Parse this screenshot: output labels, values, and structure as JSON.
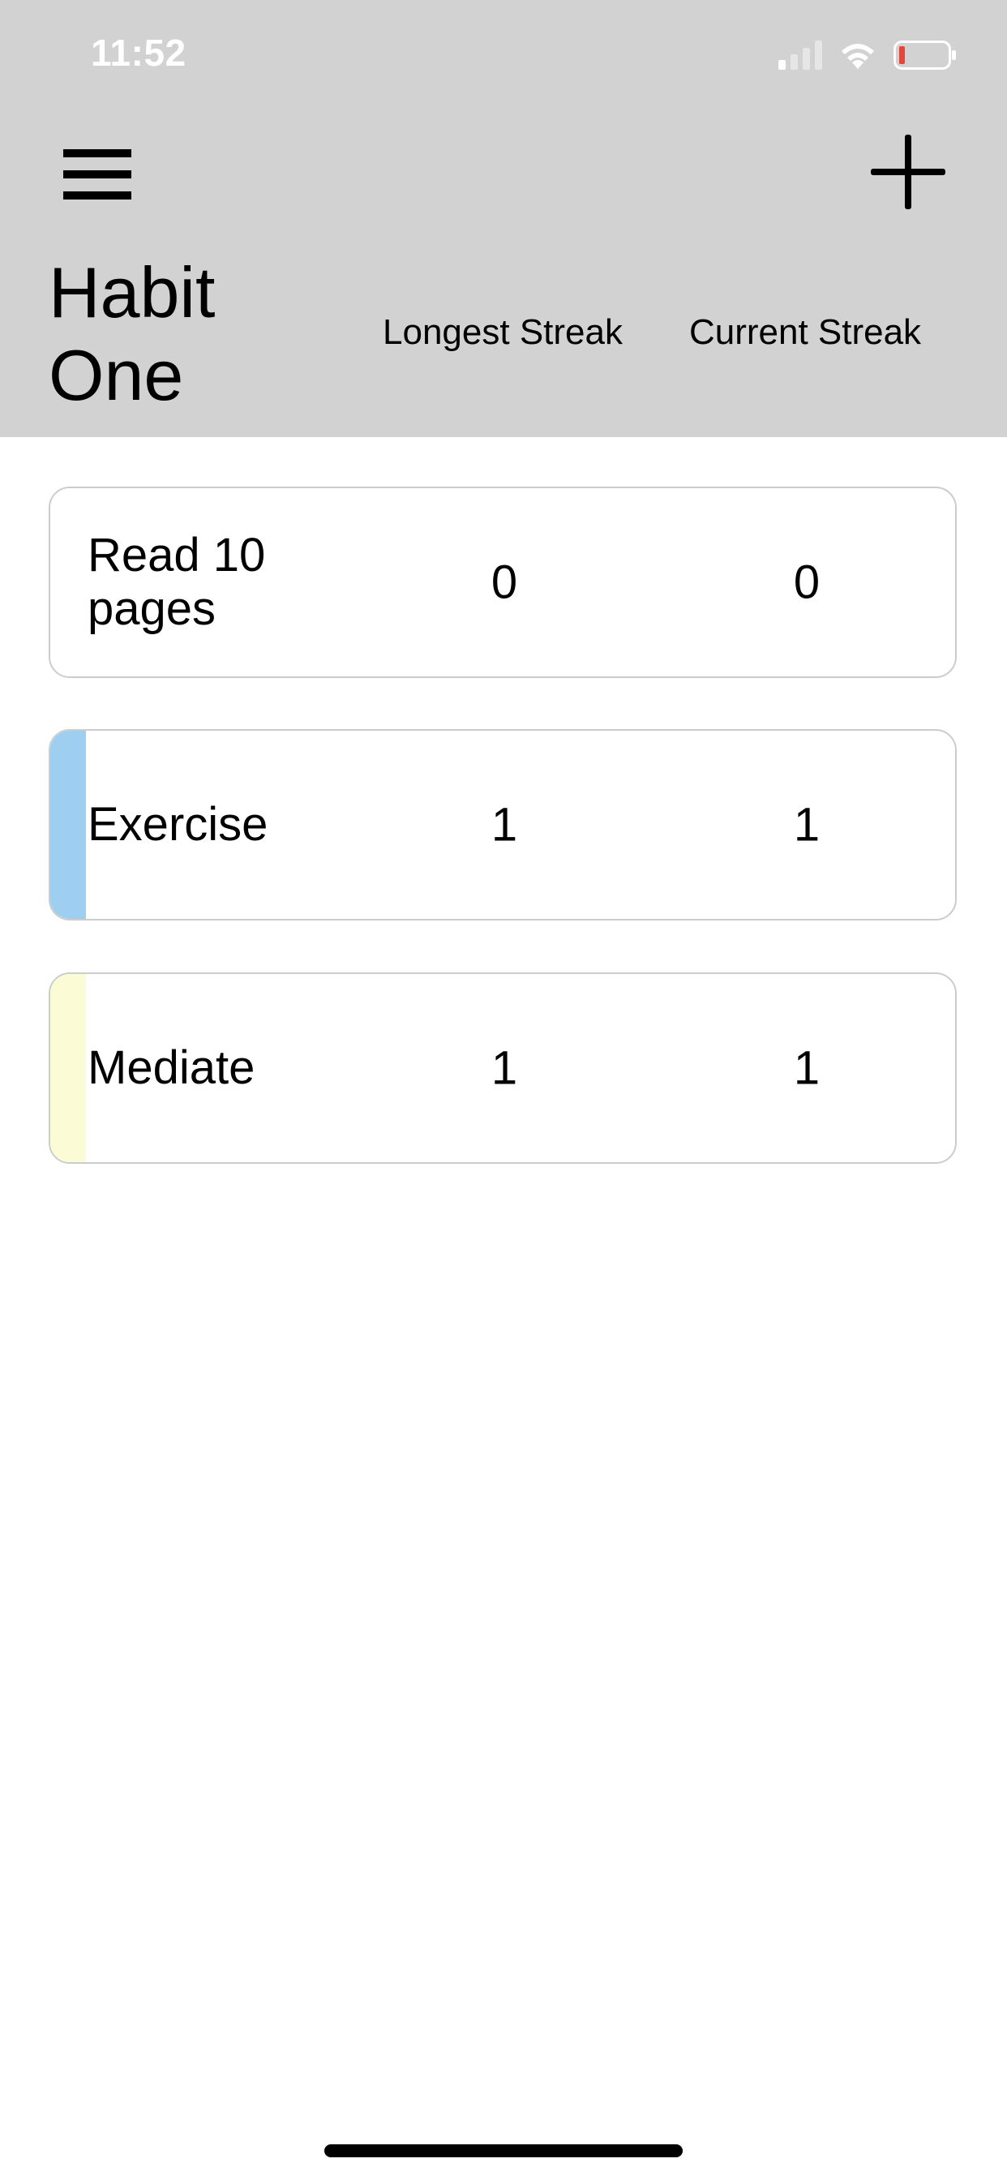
{
  "status_bar": {
    "time": "11:52",
    "icons": [
      "cellular-signal-icon",
      "wifi-icon",
      "battery-low-icon"
    ],
    "battery_level_color": "#e8443a"
  },
  "header": {
    "menu_icon": "hamburger-menu-icon",
    "add_icon": "plus-icon",
    "title": "Habit One",
    "columns": [
      "Longest Streak",
      "Current Streak"
    ],
    "background_color": "#d2d2d2"
  },
  "habits": [
    {
      "name": "Read 10 pages",
      "longest_streak": "0",
      "current_streak": "0",
      "color": "#ffffff"
    },
    {
      "name": "Exercise",
      "longest_streak": "1",
      "current_streak": "1",
      "color": "#9ecff0"
    },
    {
      "name": "Mediate",
      "longest_streak": "1",
      "current_streak": "1",
      "color": "#fbfcd6"
    }
  ]
}
